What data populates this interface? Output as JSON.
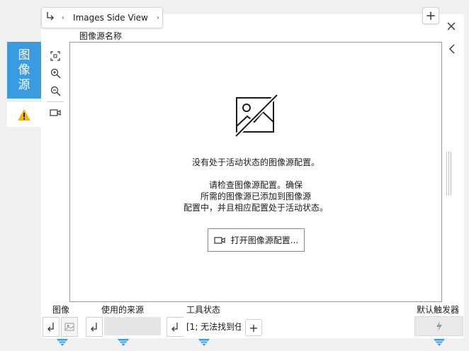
{
  "tab": {
    "title": "Images Side View"
  },
  "side_tabs": {
    "source_label_chars": [
      "图",
      "像",
      "源"
    ]
  },
  "viewer": {
    "title": "图像源名称",
    "message_inactive": "没有处于活动状态的图像源配置。",
    "message_help_1": "请检查图像源配置。确保",
    "message_help_2": "所需的图像源已添加到图像源",
    "message_help_3": "配置中，并且相应配置处于活动状态。",
    "open_button": "打开图像源配置..."
  },
  "bottom": {
    "image_label": "图像",
    "source_label": "使用的来源",
    "tool_status_label": "工具状态",
    "tool_status_value": "[1; 无法找到任",
    "trigger_label": "默认触发器"
  },
  "colors": {
    "accent": "#3b9be0",
    "warning": "#f5b400",
    "connector": "#3b9be0"
  }
}
